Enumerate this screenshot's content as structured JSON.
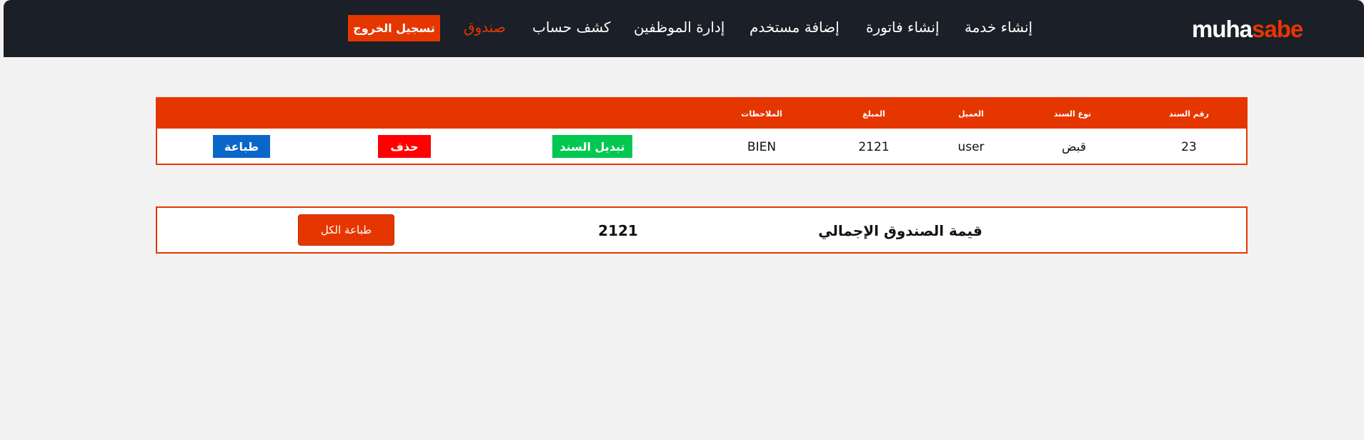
{
  "brand": {
    "logo_part1": "muha",
    "logo_part2": "sabe",
    "accent_color": "#e63600"
  },
  "nav": {
    "items": [
      {
        "label": "إنشاء خدمة"
      },
      {
        "label": "إنشاء فاتورة"
      },
      {
        "label": "إضافة مستخدم"
      },
      {
        "label": "إدارة الموظفين"
      },
      {
        "label": "كشف حساب"
      },
      {
        "label": "صندوق",
        "active": true
      }
    ],
    "logout_label": "تسجيل الخروج"
  },
  "table": {
    "headers": {
      "receipt_no": "رقم السند",
      "receipt_type": "نوع السند",
      "client": "العميل",
      "amount": "المبلغ",
      "notes": "الملاحظات"
    },
    "rows": [
      {
        "receipt_no": "23",
        "receipt_type": "قبض",
        "client": "user",
        "amount": "2121",
        "notes": "BIEN",
        "edit_label": "تبديل السند",
        "delete_label": "حذف",
        "print_label": "طباعة"
      }
    ]
  },
  "summary": {
    "label": "قيمة الصندوق الإجمالي",
    "value": "2121",
    "print_all_label": "طباعة الكل"
  },
  "colors": {
    "navbar_bg": "#1b1f27",
    "edit": "#00c850",
    "delete": "#ff0000",
    "print": "#0a66c8"
  }
}
